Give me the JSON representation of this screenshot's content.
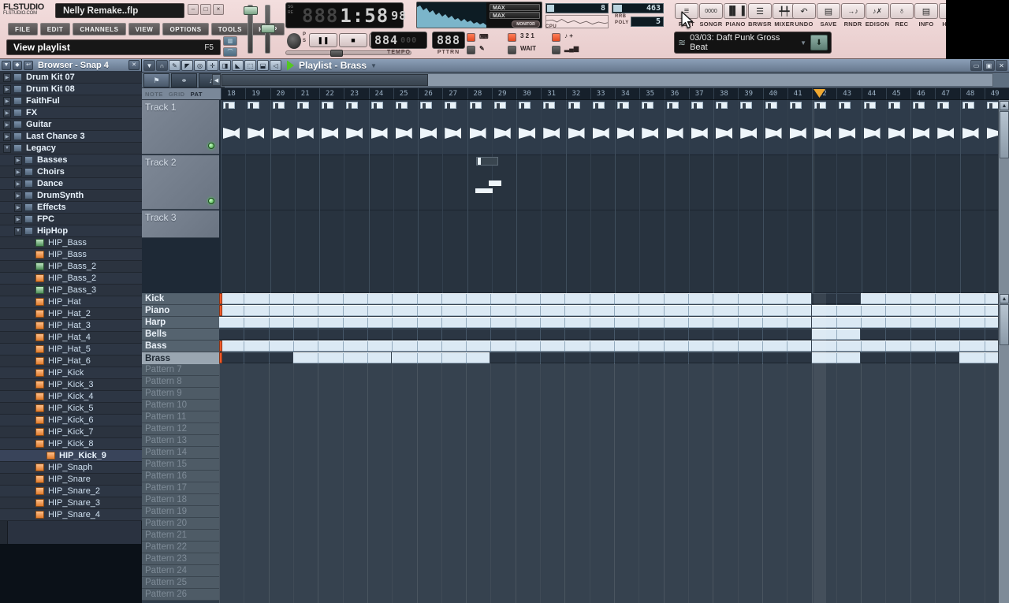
{
  "window": {
    "app_name_line1": "FLSTUDIO",
    "app_name_line2": "FLSTUDIO.COM",
    "title": "Nelly Remake..flp",
    "buttons": {
      "minimize": "–",
      "maximize": "□",
      "close": "×"
    }
  },
  "menu": {
    "items": [
      "FILE",
      "EDIT",
      "CHANNELS",
      "VIEW",
      "OPTIONS",
      "TOOLS",
      "HELP"
    ]
  },
  "hint": {
    "text": "View playlist",
    "shortcut": "F5"
  },
  "transport": {
    "time_dim": "888",
    "time_main": "1:58",
    "time_small": "98",
    "time_label_1": "SG",
    "time_label_2": "RE",
    "pause": "❚❚",
    "stop": "■",
    "record": "●",
    "tempo_value": "884",
    "tempo_sub": "000",
    "tempo_label": "TEMPO",
    "pattern_value": "888",
    "pattern_label": "PTTRN",
    "mode_letters": [
      "P",
      "S"
    ]
  },
  "meters": {
    "max_left": "MAX",
    "max_right": "MAX",
    "monitor": "MONITOR"
  },
  "cpu": {
    "cpu_value": "8",
    "cpu_label": "CPU",
    "rrb_value": "463",
    "rrb_label": "RRB",
    "poly_value": "5",
    "poly_label": "POLY"
  },
  "switches": {
    "labels": [
      "⌨",
      "3 2 1",
      "♪ +",
      "✎",
      "WAIT",
      "▂▄▆"
    ]
  },
  "toolbar_buttons": [
    {
      "caption": "PLST",
      "icon": "playlist-icon",
      "glyph": "≡"
    },
    {
      "caption": "SONGR",
      "icon": "step-sequencer-icon",
      "glyph": "0000"
    },
    {
      "caption": "PIANO",
      "icon": "piano-roll-icon",
      "glyph": "▐▌▐"
    },
    {
      "caption": "BRWSR",
      "icon": "browser-icon",
      "glyph": "☰"
    },
    {
      "caption": "MIXER",
      "icon": "mixer-icon",
      "glyph": "╇╇"
    },
    {
      "caption": "UNDO",
      "icon": "undo-icon",
      "glyph": "↶"
    },
    {
      "caption": "SAVE",
      "icon": "save-icon",
      "glyph": "Ὃe"
    },
    {
      "caption": "RNDR",
      "icon": "render-icon",
      "glyph": "→♪"
    },
    {
      "caption": "EDISON",
      "icon": "edison-icon",
      "glyph": "♪✗"
    },
    {
      "caption": "REC",
      "icon": "microphone-icon",
      "glyph": "♁"
    },
    {
      "caption": "INFO",
      "icon": "info-document-icon",
      "glyph": "☰"
    },
    {
      "caption": "HELP",
      "icon": "help-icon",
      "glyph": "?"
    }
  ],
  "online_panel": {
    "text": "03/03: Daft Punk Gross Beat",
    "icon": "rss-icon",
    "download_icon": "download-icon"
  },
  "browser": {
    "title": "Browser - Snap 4",
    "head_buttons": [
      "▼",
      "◆",
      "↩"
    ],
    "close": "✕",
    "items": [
      {
        "label": "Drum Kit 07",
        "type": "folder",
        "indent": 1,
        "expandable": true
      },
      {
        "label": "Drum Kit 08",
        "type": "folder",
        "indent": 1,
        "expandable": true
      },
      {
        "label": "FaithFul",
        "type": "folder",
        "indent": 1,
        "expandable": true
      },
      {
        "label": "FX",
        "type": "folder",
        "indent": 1,
        "expandable": true
      },
      {
        "label": "Guitar",
        "type": "folder",
        "indent": 1,
        "expandable": true
      },
      {
        "label": "Last Chance 3",
        "type": "folder",
        "indent": 1,
        "expandable": true
      },
      {
        "label": "Legacy",
        "type": "folder",
        "indent": 1,
        "expandable": true,
        "open": true
      },
      {
        "label": "Basses",
        "type": "folder",
        "indent": 2,
        "expandable": true
      },
      {
        "label": "Choirs",
        "type": "folder",
        "indent": 2,
        "expandable": true
      },
      {
        "label": "Dance",
        "type": "folder",
        "indent": 2,
        "expandable": true
      },
      {
        "label": "DrumSynth",
        "type": "folder",
        "indent": 2,
        "expandable": true
      },
      {
        "label": "Effects",
        "type": "folder",
        "indent": 2,
        "expandable": true
      },
      {
        "label": "FPC",
        "type": "folder",
        "indent": 2,
        "expandable": true
      },
      {
        "label": "HipHop",
        "type": "folder",
        "indent": 2,
        "expandable": true,
        "open": true
      },
      {
        "label": "HIP_Bass",
        "type": "green",
        "indent": 3
      },
      {
        "label": "HIP_Bass",
        "type": "orange",
        "indent": 3
      },
      {
        "label": "HIP_Bass_2",
        "type": "green",
        "indent": 3
      },
      {
        "label": "HIP_Bass_2",
        "type": "orange",
        "indent": 3
      },
      {
        "label": "HIP_Bass_3",
        "type": "green",
        "indent": 3
      },
      {
        "label": "HIP_Hat",
        "type": "orange",
        "indent": 3
      },
      {
        "label": "HIP_Hat_2",
        "type": "orange",
        "indent": 3
      },
      {
        "label": "HIP_Hat_3",
        "type": "orange",
        "indent": 3
      },
      {
        "label": "HIP_Hat_4",
        "type": "orange",
        "indent": 3
      },
      {
        "label": "HIP_Hat_5",
        "type": "orange",
        "indent": 3
      },
      {
        "label": "HIP_Hat_6",
        "type": "orange",
        "indent": 3
      },
      {
        "label": "HIP_Kick",
        "type": "orange",
        "indent": 3
      },
      {
        "label": "HIP_Kick_3",
        "type": "orange",
        "indent": 3
      },
      {
        "label": "HIP_Kick_4",
        "type": "orange",
        "indent": 3
      },
      {
        "label": "HIP_Kick_5",
        "type": "orange",
        "indent": 3
      },
      {
        "label": "HIP_Kick_6",
        "type": "orange",
        "indent": 3
      },
      {
        "label": "HIP_Kick_7",
        "type": "orange",
        "indent": 3
      },
      {
        "label": "HIP_Kick_8",
        "type": "orange",
        "indent": 3
      },
      {
        "label": "HIP_Kick_9",
        "type": "orange",
        "indent": 4,
        "selected": true
      },
      {
        "label": "HIP_Snaph",
        "type": "orange",
        "indent": 3
      },
      {
        "label": "HIP_Snare",
        "type": "orange",
        "indent": 3
      },
      {
        "label": "HIP_Snare_2",
        "type": "orange",
        "indent": 3
      },
      {
        "label": "HIP_Snare_3",
        "type": "orange",
        "indent": 3
      },
      {
        "label": "HIP_Snare_4",
        "type": "orange",
        "indent": 3
      }
    ]
  },
  "playlist": {
    "title": "Playlist - Brass",
    "tools": [
      "▼",
      "∩",
      "✎",
      "◢",
      "◎",
      "✂",
      "◀▶",
      "╲",
      "⬚",
      "⊞",
      "◁"
    ],
    "sub_tabs": [
      "⚑",
      "⚭",
      "♫"
    ],
    "mode_labels": [
      "NOTE",
      "GRID",
      "PAT"
    ],
    "mode_active": "PAT",
    "ruler_start": 18,
    "ruler_end": 49,
    "marker_bar": 42,
    "tracks": [
      {
        "name": "Track 1"
      },
      {
        "name": "Track 2"
      },
      {
        "name": "Track 3"
      }
    ],
    "patterns": [
      {
        "name": "Kick",
        "empty": false,
        "active": false
      },
      {
        "name": "Piano",
        "empty": false,
        "active": false
      },
      {
        "name": "Harp",
        "empty": false,
        "active": false
      },
      {
        "name": "Bells",
        "empty": false,
        "active": false
      },
      {
        "name": "Bass",
        "empty": false,
        "active": false
      },
      {
        "name": "Brass",
        "empty": false,
        "active": true
      },
      {
        "name": "Pattern 7",
        "empty": true
      },
      {
        "name": "Pattern 8",
        "empty": true
      },
      {
        "name": "Pattern 9",
        "empty": true
      },
      {
        "name": "Pattern 10",
        "empty": true
      },
      {
        "name": "Pattern 11",
        "empty": true
      },
      {
        "name": "Pattern 12",
        "empty": true
      },
      {
        "name": "Pattern 13",
        "empty": true
      },
      {
        "name": "Pattern 14",
        "empty": true
      },
      {
        "name": "Pattern 15",
        "empty": true
      },
      {
        "name": "Pattern 16",
        "empty": true
      },
      {
        "name": "Pattern 17",
        "empty": true
      },
      {
        "name": "Pattern 18",
        "empty": true
      },
      {
        "name": "Pattern 19",
        "empty": true
      },
      {
        "name": "Pattern 20",
        "empty": true
      },
      {
        "name": "Pattern 21",
        "empty": true
      },
      {
        "name": "Pattern 22",
        "empty": true
      },
      {
        "name": "Pattern 23",
        "empty": true
      },
      {
        "name": "Pattern 24",
        "empty": true
      },
      {
        "name": "Pattern 25",
        "empty": true
      },
      {
        "name": "Pattern 26",
        "empty": true
      }
    ]
  }
}
